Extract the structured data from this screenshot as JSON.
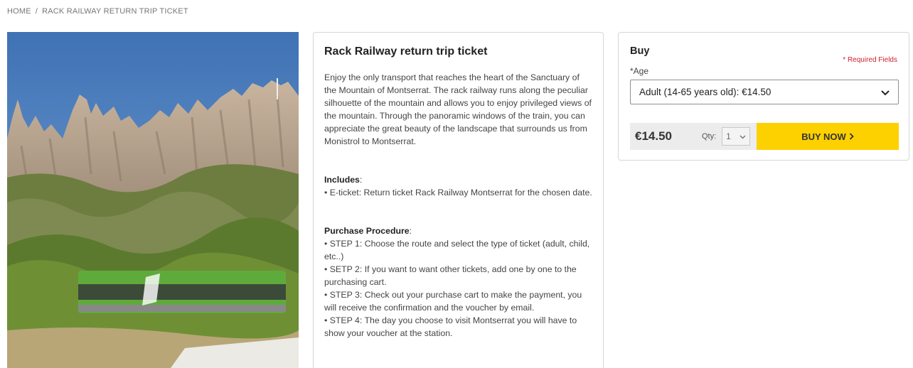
{
  "breadcrumb": {
    "home": "HOME",
    "separator": "/",
    "current": "RACK RAILWAY RETURN TRIP TICKET"
  },
  "product": {
    "title": "Rack Railway return trip ticket",
    "intro": "Enjoy the only transport that reaches the heart of the Sanctuary of the Mountain of Montserrat. The rack railway runs along the peculiar silhouette of the mountain and allows you to enjoy privileged views of the mountain. Through the panoramic windows of the train, you can appreciate the great beauty of the landscape that surrounds us from Monistrol to Montserrat.",
    "includes_heading": "Includes",
    "includes_items": [
      "• E-ticket: Return ticket Rack Railway Montserrat for the chosen date."
    ],
    "procedure_heading": "Purchase Procedure",
    "procedure_steps": [
      "• STEP 1: Choose the route and select the type of ticket (adult, child, etc..)",
      "• SETP 2: If you want to want other tickets, add one by one to the purchasing cart.",
      "• STEP 3: Check out your purchase cart to make the payment, you will receive the confirmation and the voucher by email.",
      "• STEP 4: The day you choose to visit Montserrat you will have to show your voucher at the station."
    ]
  },
  "buy": {
    "title": "Buy",
    "required_note": "* Required Fields",
    "age_label": "*Age",
    "age_selected": "Adult (14-65 years old): €14.50",
    "price": "€14.50",
    "qty_label": "Qty:",
    "qty_value": "1",
    "buy_button": "BUY NOW",
    "colors": {
      "button": "#fdd000",
      "required": "#d21f2d"
    }
  },
  "icons": {
    "chevron": "chevron-down-icon",
    "arrow": "chevron-right-icon"
  }
}
